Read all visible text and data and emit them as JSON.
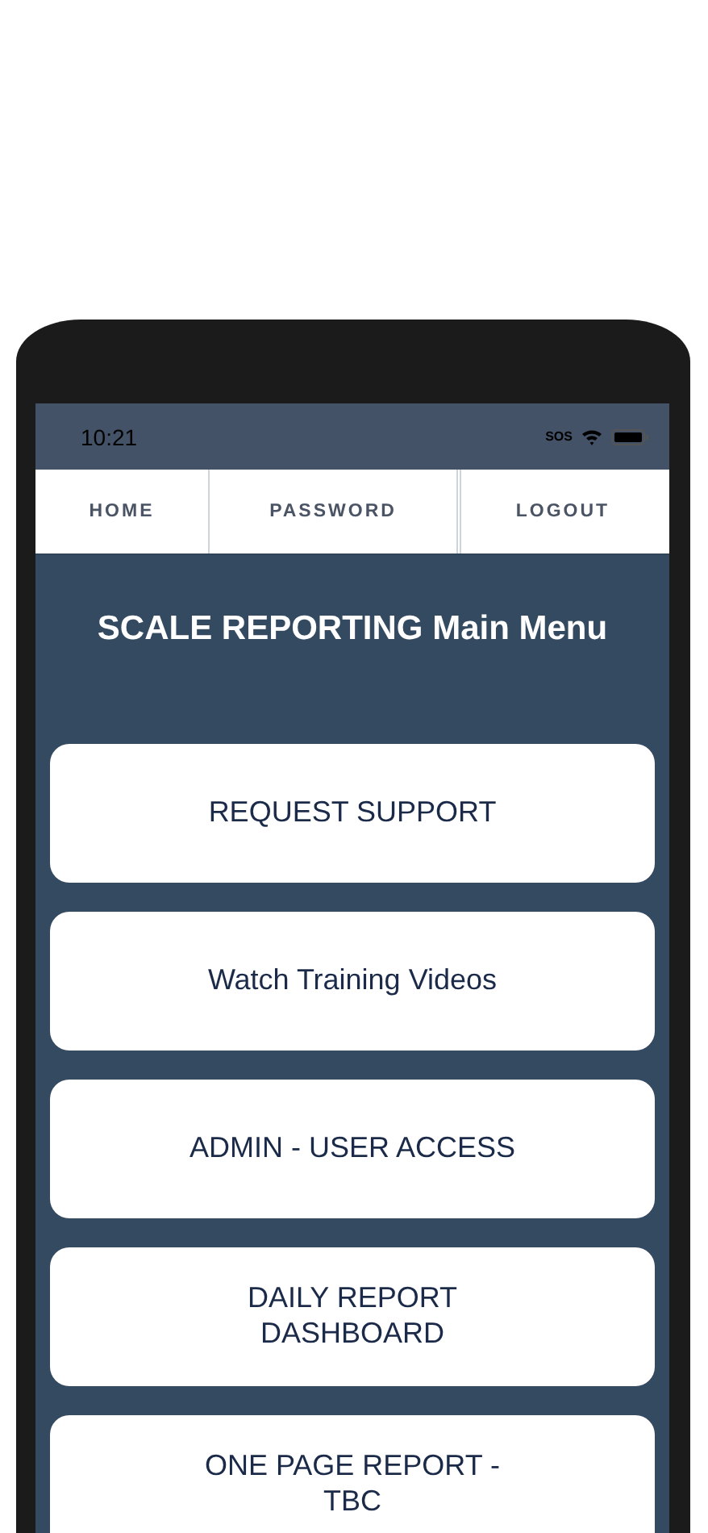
{
  "status_bar": {
    "time": "10:21",
    "sos": "SOS"
  },
  "nav_tabs": [
    {
      "label": "HOME"
    },
    {
      "label": "PASSWORD"
    },
    {
      "label": "LOGOUT"
    }
  ],
  "title": "SCALE REPORTING Main Menu",
  "menu_buttons": [
    {
      "label": "REQUEST SUPPORT"
    },
    {
      "label": "Watch Training Videos"
    },
    {
      "label": "ADMIN - USER ACCESS"
    },
    {
      "label": "DAILY REPORT DASHBOARD"
    },
    {
      "label": "ONE PAGE REPORT - TBC"
    }
  ]
}
